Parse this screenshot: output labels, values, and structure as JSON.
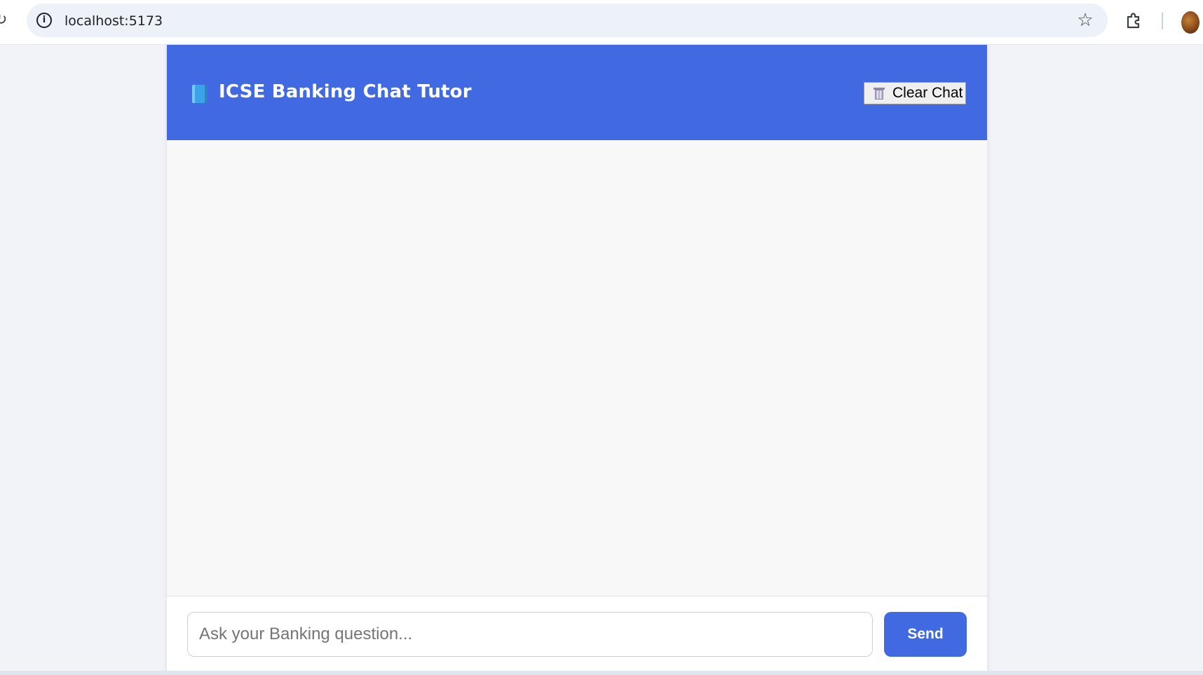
{
  "browser": {
    "url": "localhost:5173"
  },
  "app": {
    "title": "ICSE Banking Chat Tutor",
    "title_icon": "blue-book-icon",
    "clear_button_label": "Clear Chat",
    "clear_button_icon": "wastebasket-icon",
    "accent_color": "#4169e1"
  },
  "composer": {
    "placeholder": "Ask your Banking question...",
    "value": "",
    "send_label": "Send"
  }
}
